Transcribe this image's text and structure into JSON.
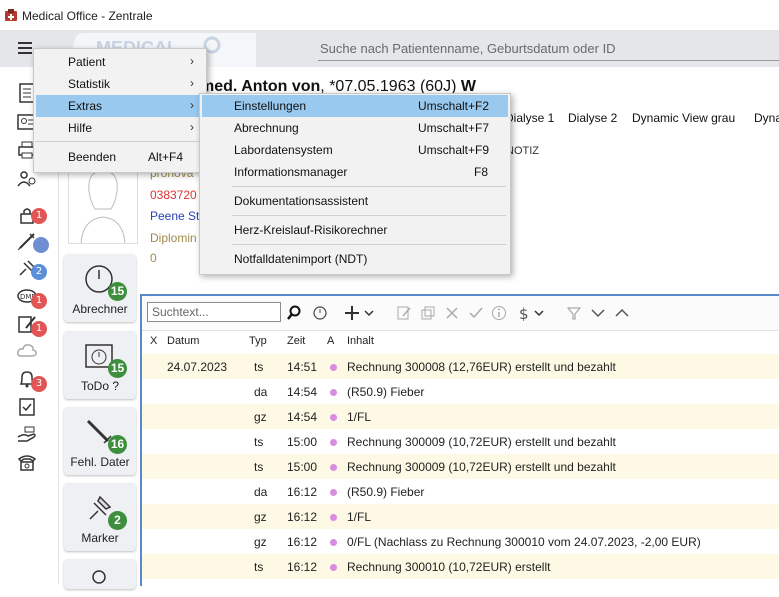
{
  "window": {
    "title": "Medical Office - Zentrale"
  },
  "header": {
    "search_placeholder": "Suche nach Patientenname, Geburtsdatum oder ID",
    "brand": "MEDICAL"
  },
  "main_menu": {
    "items": [
      {
        "label": "Patient",
        "arrow": "›"
      },
      {
        "label": "Statistik",
        "arrow": "›"
      },
      {
        "label": "Extras",
        "arrow": "›"
      },
      {
        "label": "Hilfe",
        "arrow": "›"
      },
      {
        "label": "Beenden",
        "shortcut": "Alt+F4"
      }
    ]
  },
  "extras_menu": {
    "items": [
      {
        "label": "Einstellungen",
        "shortcut": "Umschalt+F2"
      },
      {
        "label": "Abrechnung",
        "shortcut": "Umschalt+F7"
      },
      {
        "label": "Labordatensystem",
        "shortcut": "Umschalt+F9"
      },
      {
        "label": "Informationsmanager",
        "shortcut": "F8"
      },
      {
        "label": "Dokumentationsassistent"
      },
      {
        "label": "Herz-Kreislauf-Risikorechner"
      },
      {
        "label": "Notfalldatenimport (NDT)"
      }
    ]
  },
  "patient": {
    "name": "med. Anton von",
    "dob": ", *07.05.1963 (60J)",
    "gender": "W",
    "info": [
      "pronova",
      "0383720",
      "Peene St",
      "Diplomin",
      "0"
    ]
  },
  "tabs": [
    "Dialyse 1",
    "Dialyse 2",
    "Dynamic View grau",
    "Dyna"
  ],
  "notiz_label": "NOTIZ",
  "sidebar_badges": [
    "1",
    "",
    "2",
    "1",
    "1",
    "3"
  ],
  "tiles": [
    {
      "label": "Abrechner",
      "count": "15"
    },
    {
      "label": "ToDo ?",
      "count": "15"
    },
    {
      "label": "Fehl. Dater",
      "count": "16"
    },
    {
      "label": "Marker",
      "count": "2"
    }
  ],
  "journal": {
    "search_placeholder": "Suchtext...",
    "columns": [
      "X",
      "Datum",
      "Typ",
      "Zeit",
      "A",
      "Inhalt"
    ],
    "rows": [
      {
        "date": "24.07.2023",
        "typ": "ts",
        "zeit": "14:51",
        "inhalt": "Rechnung 300008 (12,76EUR) erstellt und bezahlt"
      },
      {
        "date": "",
        "typ": "da",
        "zeit": "14:54",
        "inhalt": "(R50.9) Fieber"
      },
      {
        "date": "",
        "typ": "gz",
        "zeit": "14:54",
        "inhalt": "1/FL"
      },
      {
        "date": "",
        "typ": "ts",
        "zeit": "15:00",
        "inhalt": "Rechnung 300009 (10,72EUR) erstellt und bezahlt"
      },
      {
        "date": "",
        "typ": "ts",
        "zeit": "15:00",
        "inhalt": "Rechnung 300009 (10,72EUR) erstellt und bezahlt"
      },
      {
        "date": "",
        "typ": "da",
        "zeit": "16:12",
        "inhalt": "(R50.9) Fieber"
      },
      {
        "date": "",
        "typ": "gz",
        "zeit": "16:12",
        "inhalt": "1/FL"
      },
      {
        "date": "",
        "typ": "gz",
        "zeit": "16:12",
        "inhalt": "0/FL (Nachlass zu Rechnung 300010 vom 24.07.2023, -2,00 EUR)"
      },
      {
        "date": "",
        "typ": "ts",
        "zeit": "16:12",
        "inhalt": "Rechnung 300010 (10,72EUR) erstellt"
      }
    ]
  },
  "colors": {
    "menu_highlight": "#99c9ef",
    "journal_border": "#5a88cc",
    "badge_red": "#e15555",
    "badge_green": "#3d8f3d",
    "row_odd": "#fdf9e4"
  }
}
